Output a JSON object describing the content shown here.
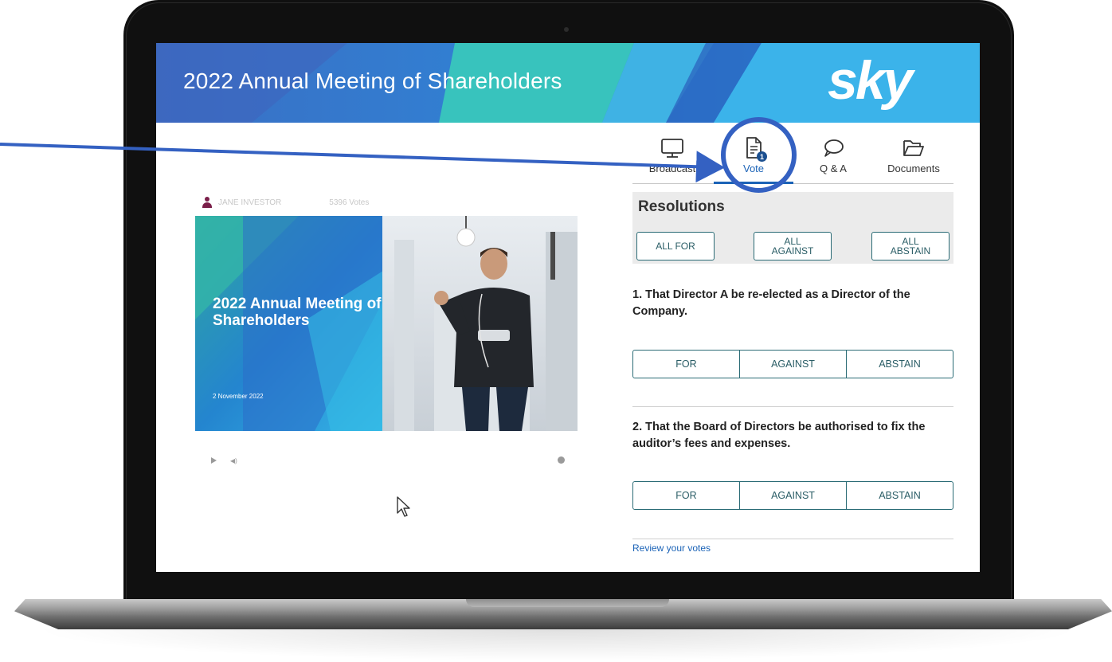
{
  "banner": {
    "title": "2022 Annual Meeting of Shareholders",
    "logo": "sky",
    "colors": {
      "blue": "#2e79c9",
      "teal": "#36c4c0",
      "light_blue": "#4aa7e8"
    }
  },
  "player": {
    "presenter_name": "JANE INVESTOR",
    "views": "5396 Votes",
    "slide": {
      "title": "2022 Annual Meeting of Shareholders",
      "date": "2 November 2022"
    }
  },
  "tabs": [
    {
      "label": "Broadcast",
      "icon": "monitor-icon"
    },
    {
      "label": "Vote",
      "icon": "document-icon",
      "badge": "1",
      "active": true
    },
    {
      "label": "Q & A",
      "icon": "speech-bubble-icon"
    },
    {
      "label": "Documents",
      "icon": "folder-icon"
    }
  ],
  "resolutions": {
    "title": "Resolutions",
    "all_for": "ALL FOR",
    "all_against": "ALL AGAINST",
    "all_abstain": "ALL ABSTAIN",
    "items": [
      {
        "text": "1. That Director A be re-elected as a Director of the Company.",
        "options": [
          "FOR",
          "AGAINST",
          "ABSTAIN"
        ]
      },
      {
        "text": "2. That the Board of Directors be authorised to fix the auditor’s fees and expenses.",
        "options": [
          "FOR",
          "AGAINST",
          "ABSTAIN"
        ]
      }
    ],
    "review_link": "Review your votes"
  },
  "accent_color": "#1b63b7",
  "annotation_color": "#3461c2"
}
